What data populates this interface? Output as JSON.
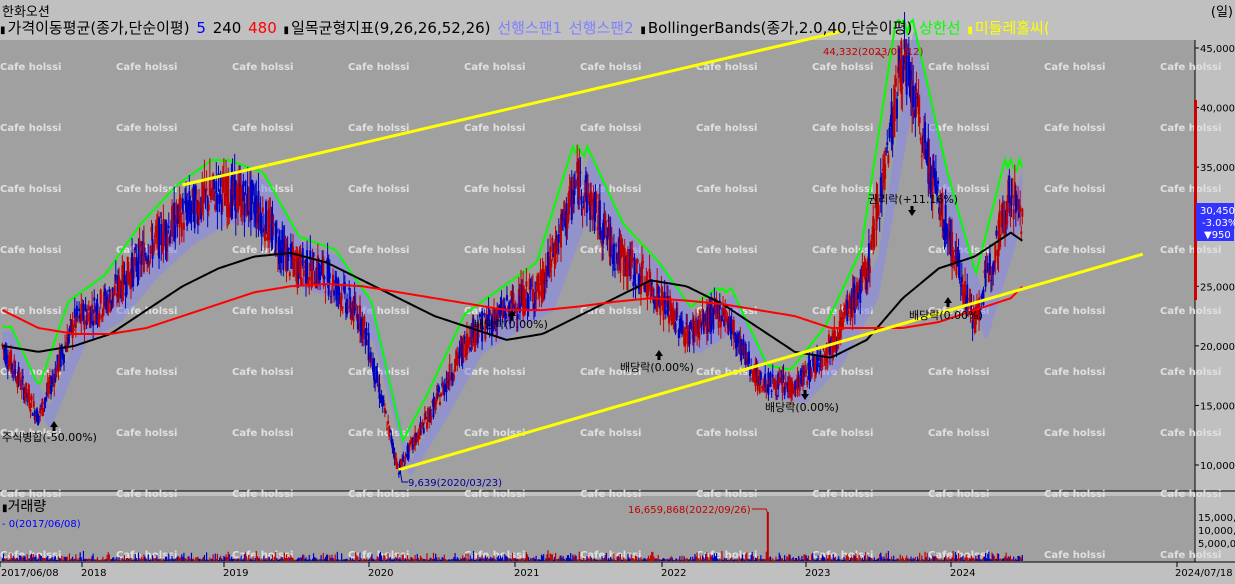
{
  "header": {
    "stock_name": "한화오션",
    "period_label": "(일)"
  },
  "legend": {
    "ma": {
      "label": "가격이동평균(종가,단순이평)",
      "p1": "5",
      "p2": "240",
      "p3": "480"
    },
    "ichimoku": {
      "label": "일목균형지표(9,26,26,52,26)",
      "span1": "선행스팬1",
      "span2": "선행스팬2"
    },
    "bollinger": {
      "label": "BollingerBands(종가,2.0,40,단순이평)",
      "upper": "상한선",
      "mid": "미들레홀씨("
    },
    "colors": {
      "ma5": "#0000ff",
      "ma240": "#000000",
      "ma480": "#ff0000",
      "span1": "#8080ff",
      "span2": "#8080ff",
      "upper": "#00ff00",
      "mid": "#ffff00",
      "trendline": "#ffff00",
      "candle_up": "#c00000",
      "candle_down": "#0000c0"
    }
  },
  "watermark": "Cafe holssi",
  "price_panel": {
    "y_ticks": [
      "45,000",
      "40,000",
      "35,000",
      "30,000",
      "25,000",
      "20,000",
      "15,000",
      "10,000"
    ],
    "current_price": "30,450",
    "current_change_pct": "-3.03%",
    "current_change": "▼950"
  },
  "annotations": {
    "high": "44,332(2023/07/12)",
    "low": "9,639(2020/03/23)",
    "merge": "주식병합(-50.00%)",
    "div1": "배당락(0.00%)",
    "div2": "배당락(0.00%)",
    "div3": "배당락(0.00%)",
    "rights": "권리락(+11.16%)",
    "div4": "배당락(0.00%)"
  },
  "volume_panel": {
    "title": "거래량",
    "info": "- 0(2017/06/08)",
    "peak": "16,659,868(2022/09/26)",
    "y_ticks": [
      "15,000,",
      "10,000,",
      "5,000,00"
    ]
  },
  "x_axis": {
    "labels": [
      "2017/06/08",
      "2018",
      "2019",
      "2020",
      "2021",
      "2022",
      "2023",
      "2024",
      "2024/07/18"
    ]
  },
  "chart_data": {
    "type": "line",
    "title": "한화오션",
    "x": [
      "2017-06",
      "2017-09",
      "2017-12",
      "2018-03",
      "2018-06",
      "2018-09",
      "2018-12",
      "2019-03",
      "2019-06",
      "2019-09",
      "2019-12",
      "2020-03",
      "2020-06",
      "2020-09",
      "2020-12",
      "2021-03",
      "2021-06",
      "2021-09",
      "2021-12",
      "2022-03",
      "2022-06",
      "2022-09",
      "2022-12",
      "2023-03",
      "2023-06",
      "2023-09",
      "2023-12",
      "2024-03",
      "2024-06",
      "2024-07"
    ],
    "series": [
      {
        "name": "5",
        "values": [
          20000,
          14000,
          22000,
          24000,
          28000,
          31000,
          33000,
          32000,
          27000,
          26000,
          22000,
          9639,
          15000,
          21000,
          23000,
          25000,
          34000,
          28000,
          25000,
          21000,
          23000,
          17000,
          16500,
          20000,
          26000,
          44332,
          32000,
          22000,
          33000,
          30450
        ]
      },
      {
        "name": "240",
        "values": [
          20000,
          19500,
          20000,
          21000,
          23000,
          25000,
          26500,
          27500,
          27800,
          27000,
          25500,
          24000,
          22500,
          21500,
          20500,
          21000,
          22500,
          24000,
          25500,
          25000,
          23500,
          21500,
          19500,
          19000,
          20500,
          24000,
          26500,
          27500,
          29500,
          28800
        ]
      },
      {
        "name": "480",
        "values": [
          23000,
          21500,
          21000,
          21000,
          21500,
          22500,
          23500,
          24500,
          25000,
          25200,
          25000,
          24500,
          24000,
          23500,
          23000,
          23000,
          23300,
          23700,
          24000,
          23800,
          23500,
          23000,
          22500,
          21500,
          21500,
          21500,
          22000,
          23000,
          24000,
          25000
        ]
      }
    ],
    "ylim": [
      8500,
      46500
    ],
    "log_scale": false,
    "grid": false,
    "trendlines": [
      {
        "from": [
          "2018-09",
          33500
        ],
        "to": [
          "2023-09",
          46000
        ]
      },
      {
        "from": [
          "2020-03",
          9600
        ],
        "to": [
          "2024-07",
          23500
        ]
      }
    ]
  }
}
